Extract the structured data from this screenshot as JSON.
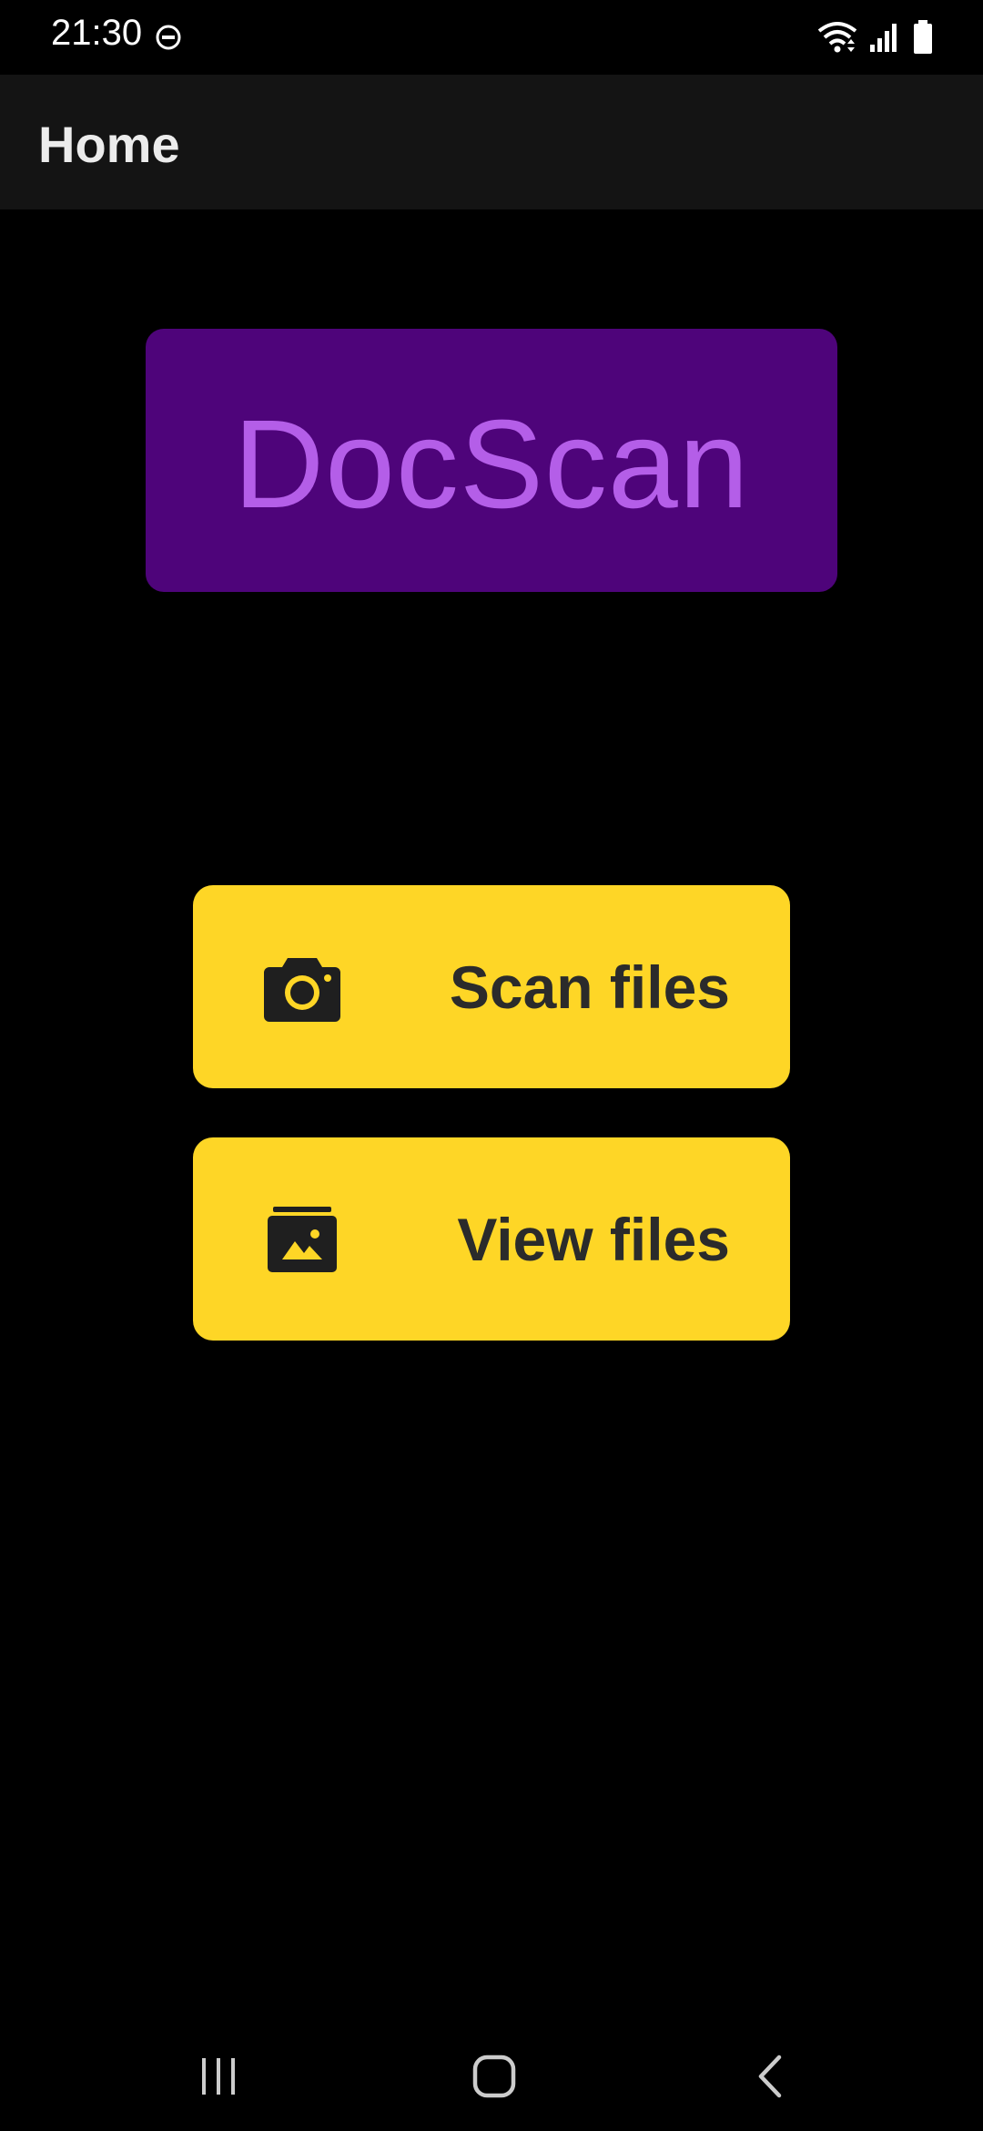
{
  "status_bar": {
    "time": "21:30",
    "icons": [
      "do-not-disturb-icon",
      "wifi-icon",
      "signal-icon",
      "battery-icon"
    ]
  },
  "app_bar": {
    "title": "Home"
  },
  "logo": {
    "text": "DocScan",
    "background_color": "#4e047a",
    "text_color": "#b45ee8"
  },
  "actions": {
    "scan": {
      "label": "Scan files",
      "icon": "camera-icon"
    },
    "view": {
      "label": "View files",
      "icon": "photo-album-icon"
    },
    "button_color": "#fed626"
  },
  "nav_bar": {
    "icons": [
      "recents-icon",
      "home-icon",
      "back-icon"
    ]
  }
}
